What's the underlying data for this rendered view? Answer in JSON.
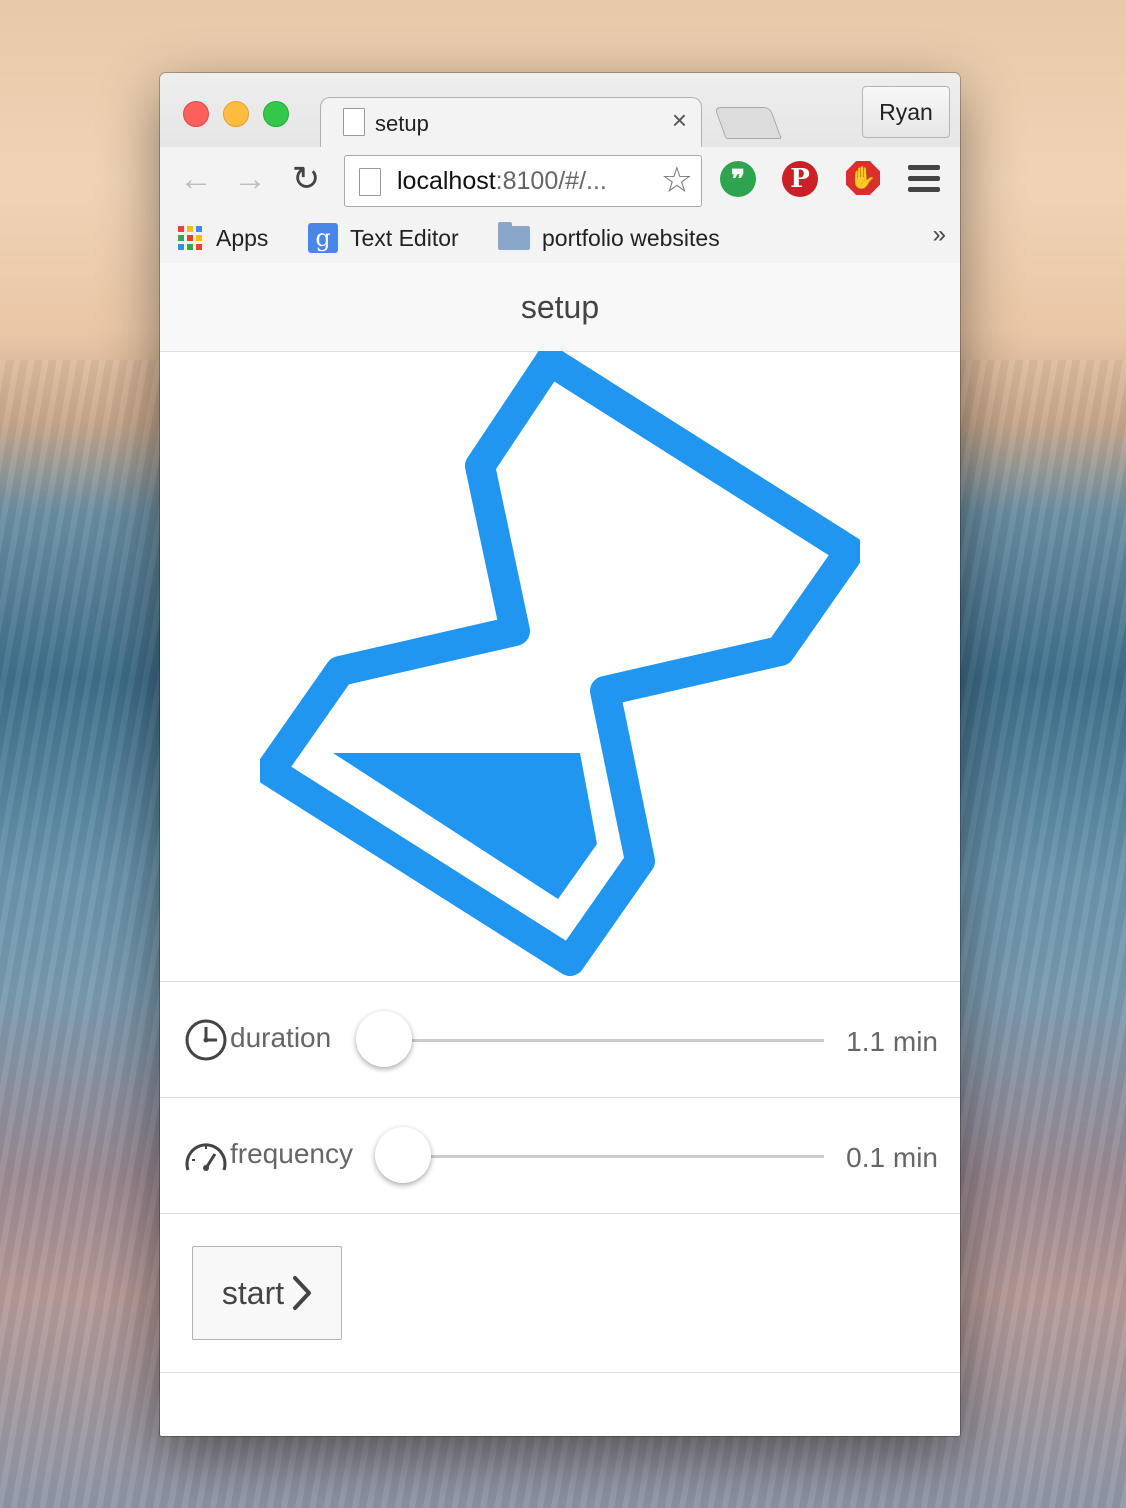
{
  "browser": {
    "profile_name": "Ryan",
    "tab_title": "setup",
    "url_host": "localhost",
    "url_rest": ":8100/#/...",
    "bookmarks": [
      {
        "label": "Apps",
        "icon": "apps-grid-icon"
      },
      {
        "label": "Text Editor",
        "icon": "google-g-icon"
      },
      {
        "label": "portfolio websites",
        "icon": "folder-icon"
      }
    ],
    "bookmarks_overflow": "»",
    "extensions": [
      "hangouts-icon",
      "pinterest-icon",
      "adblock-stop-icon"
    ]
  },
  "app": {
    "title": "setup",
    "accent_color": "#2196f0",
    "duration": {
      "label": "duration",
      "value_text": "1.1 min",
      "slider_fraction": 0.0
    },
    "frequency": {
      "label": "frequency",
      "value_text": "0.1 min",
      "slider_fraction": 0.0
    },
    "start_label": "start"
  }
}
